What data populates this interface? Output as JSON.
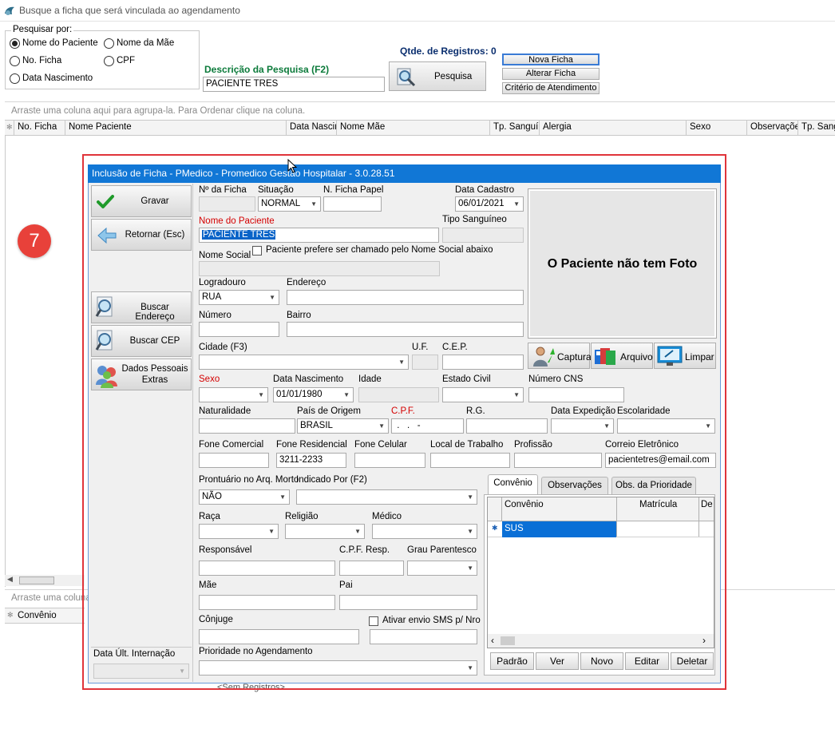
{
  "window": {
    "title": "Busque a ficha que será vinculada ao agendamento"
  },
  "search": {
    "group_label": "Pesquisar por:",
    "options": [
      "Nome do Paciente",
      "Nome da Mãe",
      "No. Ficha",
      "CPF",
      "Data Nascimento"
    ],
    "selected": "Nome do Paciente",
    "description_label": "Descrição da Pesquisa (F2)",
    "description_value": "PACIENTE TRES",
    "search_button": "Pesquisa",
    "count_label": "Qtde. de Registros: 0"
  },
  "actions": {
    "nova_ficha": "Nova Ficha",
    "alterar_ficha": "Alterar Ficha",
    "criterio": "Critério de Atendimento"
  },
  "grid": {
    "group_hint": "Arraste uma coluna aqui para agrupa-la. Para Ordenar clique na coluna.",
    "columns": [
      "No. Ficha",
      "Nome Paciente",
      "Data Nascin",
      "Nome Mãe",
      "Tp. Sanguír",
      "Alergia",
      "Sexo",
      "Observaçõe",
      "Tp. Sang"
    ]
  },
  "lower_grid": {
    "group_hint": "Arraste uma coluna",
    "column": "Convênio",
    "empty": "<Sem Registros>"
  },
  "annotation": {
    "step": "7"
  },
  "dialog": {
    "title": "Inclusão de Ficha - PMedico - Promedico Gestão Hospitalar - 3.0.28.51",
    "side": {
      "gravar": "Gravar",
      "retornar": "Retornar (Esc)",
      "buscar_endereco": "Buscar Endereço",
      "buscar_cep": "Buscar CEP",
      "dados_line1": "Dados Pessoais",
      "dados_line2": "Extras",
      "data_ult_internacao": "Data Últ. Internação"
    },
    "fields": {
      "n_ficha": "Nº da Ficha",
      "situacao": "Situação",
      "situacao_value": "NORMAL",
      "n_ficha_papel": "N. Ficha Papel",
      "data_cadastro": "Data Cadastro",
      "data_cadastro_value": "06/01/2021",
      "nome_paciente": "Nome do Paciente",
      "nome_paciente_value": "PACIENTE TRES",
      "tipo_sanguineo": "Tipo Sanguíneo",
      "nome_social": "Nome Social",
      "nome_social_check": "Paciente prefere ser chamado pelo Nome Social abaixo",
      "logradouro": "Logradouro",
      "logradouro_value": "RUA",
      "endereco": "Endereço",
      "numero": "Número",
      "bairro": "Bairro",
      "cidade": "Cidade (F3)",
      "uf": "U.F.",
      "cep": "C.E.P.",
      "sexo": "Sexo",
      "data_nascimento": "Data Nascimento",
      "data_nascimento_value": "01/01/1980",
      "idade": "Idade",
      "estado_civil": "Estado Civil",
      "numero_cns": "Número CNS",
      "naturalidade": "Naturalidade",
      "pais_origem": "País de Origem",
      "pais_origem_value": "BRASIL",
      "cpf": "C.P.F.",
      "cpf_value": " .   .   -",
      "rg": "R.G.",
      "data_expedicao": "Data Expedição",
      "escolaridade": "Escolaridade",
      "fone_comercial": "Fone Comercial",
      "fone_residencial": "Fone Residencial",
      "fone_residencial_value": "3211-2233",
      "fone_celular": "Fone Celular",
      "local_trabalho": "Local de Trabalho",
      "profissao": "Profissão",
      "correio": "Correio Eletrônico",
      "correio_value": "pacientetres@email.com",
      "prontuario": "Prontuário no Arq. Morto",
      "prontuario_value": "NÃO",
      "indicado_por": "Indicado Por (F2)",
      "raca": "Raça",
      "religiao": "Religião",
      "medico": "Médico",
      "responsavel": "Responsável",
      "cpf_resp": "C.P.F. Resp.",
      "grau_parentesco": "Grau Parentesco",
      "mae": "Mãe",
      "pai": "Pai",
      "conjuge": "Cônjuge",
      "sms": "Ativar envio SMS p/ Nro",
      "prioridade": "Prioridade no Agendamento"
    },
    "photo": {
      "no_photo": "O Paciente não tem Foto",
      "capturar": "Capturar",
      "arquivo": "Arquivo",
      "limpar": "Limpar"
    },
    "tabs": [
      "Convênio",
      "Observações",
      "Obs. da Prioridade"
    ],
    "convenio_grid": {
      "columns": [
        "Convênio",
        "Matrícula",
        "De"
      ],
      "rows": [
        {
          "convenio": "SUS",
          "matricula": ""
        }
      ]
    },
    "grid_buttons": [
      "Padrão",
      "Ver",
      "Novo",
      "Editar",
      "Deletar"
    ]
  }
}
